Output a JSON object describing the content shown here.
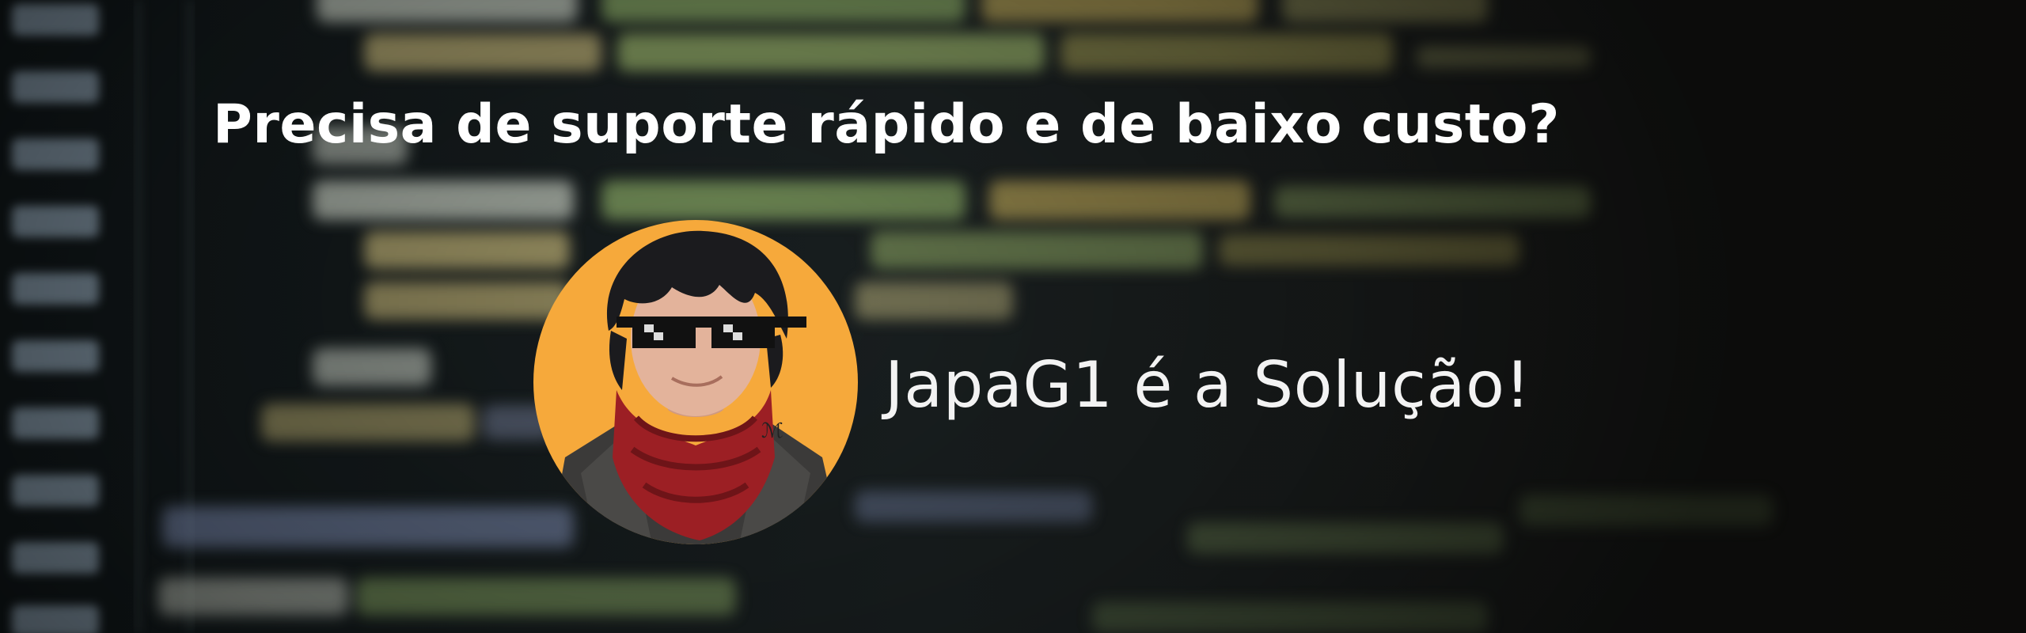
{
  "headline": "Precisa de suporte rápido e de baixo custo?",
  "tagline": "JapaG1 é a Solução!",
  "icons": {
    "avatar": "cartoon-avatar-icon",
    "background": "blurred-code-background"
  },
  "colors": {
    "avatar_background": "#f6a93b",
    "scarf": "#9c1f24",
    "hair": "#1b1b1e",
    "text": "#ffffff"
  }
}
